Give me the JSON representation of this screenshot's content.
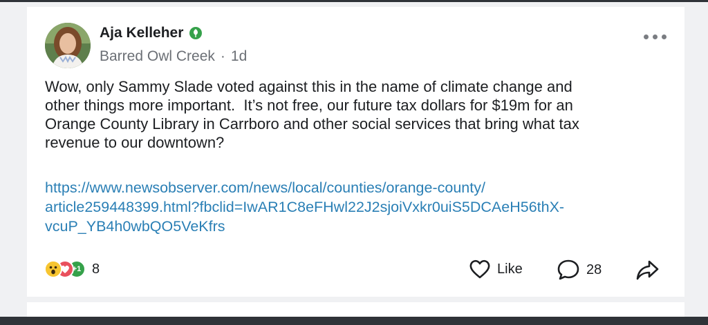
{
  "post": {
    "author_name": "Aja Kelleher",
    "neighborhood": "Barred Owl Creek",
    "separator": "·",
    "time_ago": "1d",
    "body": "Wow, only Sammy Slade voted against this in the name of climate change and\nother things more important.  It’s not free, our future tax dollars for $19m for an\nOrange County Library in Carrboro and other social services that bring what tax\nrevenue to our downtown?",
    "link": "https://www.newsobserver.com/news/local/counties/orange-county/article259448399.html?fbclid=IwAR1C8eFHwl22J2sjoiVxkr0uiS5DCAeH56thX-vcuP_YB4h0wbQO5VeKfrs",
    "link_display_lines": [
      "https://www.newsobserver.com/news/local/counties/orange-county/",
      "article259448399.html?fbclid=IwAR1C8eFHwl22J2sjoiVxkr0uiS5DCAeH56thX-",
      "vcuP_YB4h0wbQO5VeKfrs"
    ]
  },
  "reactions": {
    "plus_badge": "+1",
    "count": "8"
  },
  "actions": {
    "like_label": "Like",
    "comment_count": "28"
  },
  "colors": {
    "link": "#2a7fb5",
    "verified_badge": "#35a14a"
  },
  "icons": [
    "verified-leaf-icon",
    "more-options-icon",
    "wow-reaction-icon",
    "love-reaction-icon",
    "plus-one-reaction-icon",
    "heart-outline-icon",
    "comment-bubble-icon",
    "share-arrow-icon"
  ]
}
